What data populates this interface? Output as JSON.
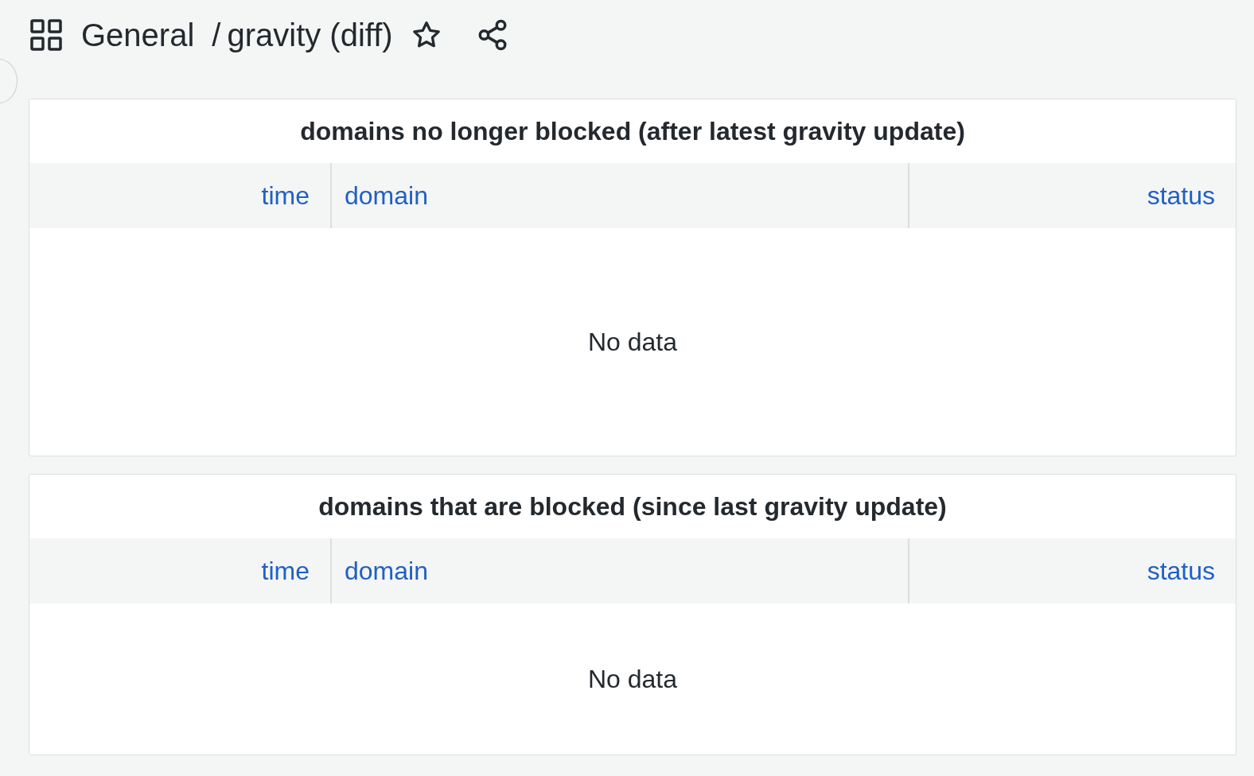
{
  "header": {
    "folder": "General",
    "separator": "/",
    "title": "gravity (diff)",
    "starred": false
  },
  "panels": [
    {
      "title": "domains no longer blocked (after latest gravity update)",
      "columns": [
        "time",
        "domain",
        "status"
      ],
      "empty_message": "No data"
    },
    {
      "title": "domains that are blocked (since last gravity update)",
      "columns": [
        "time",
        "domain",
        "status"
      ],
      "empty_message": "No data"
    }
  ]
}
